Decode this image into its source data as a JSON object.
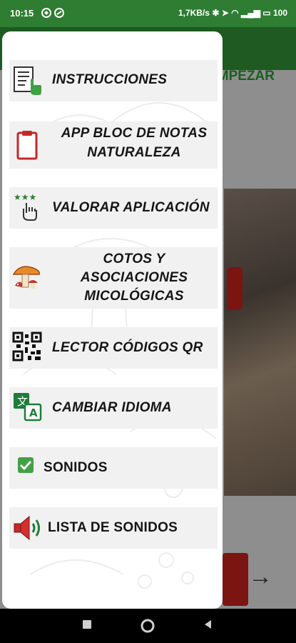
{
  "status_bar": {
    "time": "10:15",
    "speed": "1,7KB/s",
    "battery": "100"
  },
  "background": {
    "start_label": "EMPEZAR"
  },
  "drawer": {
    "items": [
      {
        "label": "INSTRUCCIONES",
        "icon": "instructions-document-icon"
      },
      {
        "label_lines": [
          "APP BLOC DE NOTAS",
          "NATURALEZA"
        ],
        "icon": "clipboard-icon"
      },
      {
        "label": "VALORAR APLICACIÓN",
        "icon": "rate-stars-icon"
      },
      {
        "label_lines": [
          "COTOS Y",
          "ASOCIACIONES",
          "MICOLÓGICAS"
        ],
        "icon": "mushroom-icon"
      },
      {
        "label": "LECTOR CÓDIGOS QR",
        "icon": "qr-code-icon"
      },
      {
        "label": "CAMBIAR IDIOMA",
        "icon": "translate-icon"
      },
      {
        "label": "SONIDOS",
        "icon": "checkbox-checked-icon",
        "checked": true
      },
      {
        "label": "LISTA DE SONIDOS",
        "icon": "speaker-icon"
      }
    ]
  },
  "colors": {
    "status_bar": "#2e7d32",
    "accent_green": "#1b5e20",
    "item_background": "#f1f1f1",
    "checkbox": "#43a047"
  }
}
